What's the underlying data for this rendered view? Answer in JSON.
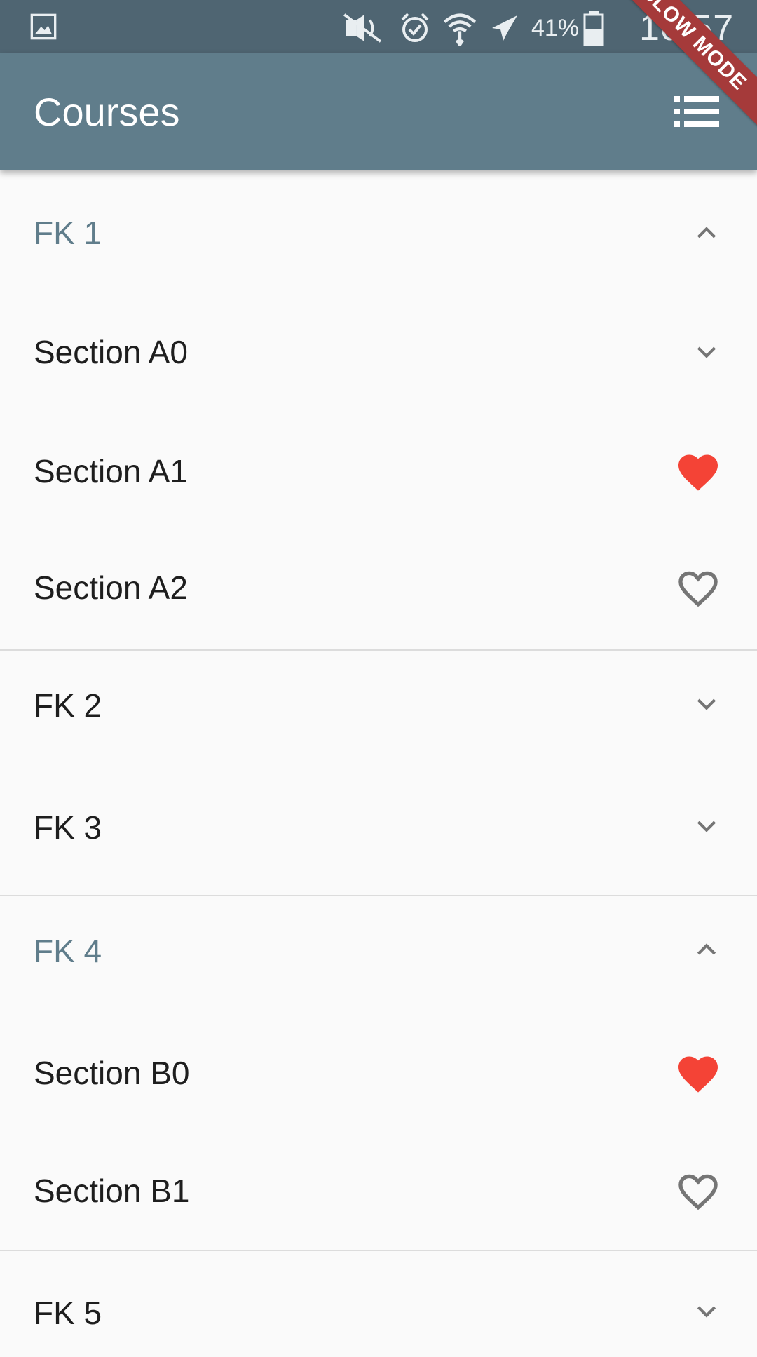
{
  "status_bar": {
    "battery_percent": "41%",
    "time": "10:57",
    "icons": [
      "gallery-icon",
      "mute-icon",
      "alarm-icon",
      "wifi-icon",
      "airplane-icon",
      "battery-icon"
    ]
  },
  "app_bar": {
    "title": "Courses",
    "action_icon": "list-icon",
    "color": "#607d8b"
  },
  "debug_banner": "SLOW MODE",
  "courses": [
    {
      "label": "FK 1",
      "expanded": true,
      "sections": [
        {
          "label": "Section A0",
          "trailing": "chevron-down"
        },
        {
          "label": "Section A1",
          "trailing": "heart-filled"
        },
        {
          "label": "Section A2",
          "trailing": "heart-outline"
        }
      ]
    },
    {
      "label": "FK 2",
      "expanded": false
    },
    {
      "label": "FK 3",
      "expanded": false
    },
    {
      "label": "FK 4",
      "expanded": true,
      "sections": [
        {
          "label": "Section B0",
          "trailing": "heart-filled"
        },
        {
          "label": "Section B1",
          "trailing": "heart-outline"
        }
      ]
    },
    {
      "label": "FK 5",
      "expanded": false
    }
  ],
  "colors": {
    "accent": "#607d8b",
    "heart": "#f44336",
    "icon_grey": "#757575"
  }
}
